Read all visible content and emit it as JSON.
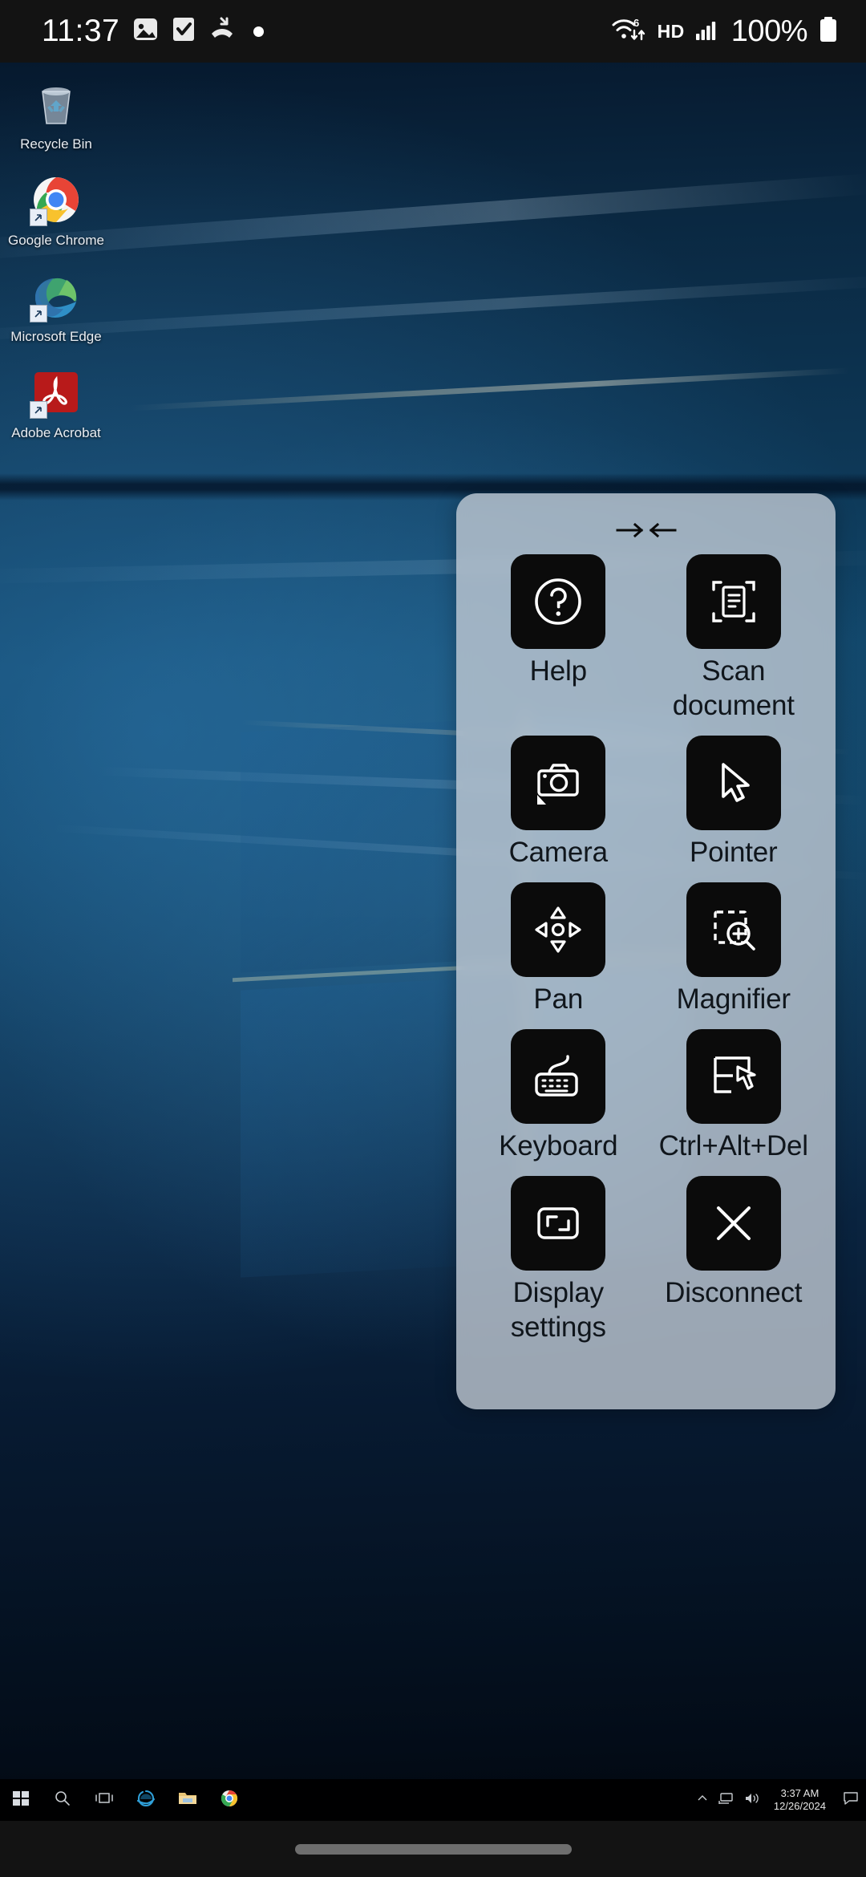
{
  "status_bar": {
    "time": "11:37",
    "battery_percent": "100%",
    "network_label": "HD",
    "wifi_generation": "6",
    "icons": [
      "image-icon",
      "check-square-icon",
      "missed-call-icon",
      "dot-icon",
      "wifi-6-icon",
      "hd-icon",
      "cellular-signal-icon",
      "battery-icon"
    ]
  },
  "desktop": {
    "icons": [
      {
        "label": "Recycle Bin",
        "icon": "recycle-bin-icon",
        "has_shortcut_badge": false
      },
      {
        "label": "Google Chrome",
        "icon": "chrome-icon",
        "has_shortcut_badge": true
      },
      {
        "label": "Microsoft Edge",
        "icon": "edge-icon",
        "has_shortcut_badge": true
      },
      {
        "label": "Adobe Acrobat",
        "icon": "acrobat-icon",
        "has_shortcut_badge": true
      }
    ]
  },
  "control_panel": {
    "collapse_icon": "collapse-arrows-icon",
    "items": [
      {
        "label": "Help",
        "icon": "question-circle-icon"
      },
      {
        "label": "Scan document",
        "icon": "scan-document-icon"
      },
      {
        "label": "Camera",
        "icon": "camera-icon"
      },
      {
        "label": "Pointer",
        "icon": "cursor-arrow-icon"
      },
      {
        "label": "Pan",
        "icon": "pan-arrows-icon"
      },
      {
        "label": "Magnifier",
        "icon": "magnifier-icon"
      },
      {
        "label": "Keyboard",
        "icon": "keyboard-icon"
      },
      {
        "label": "Ctrl+Alt+Del",
        "icon": "ctrl-alt-del-icon"
      },
      {
        "label": "Display settings",
        "icon": "display-settings-icon"
      },
      {
        "label": "Disconnect",
        "icon": "close-x-icon"
      }
    ]
  },
  "taskbar": {
    "buttons": [
      {
        "name": "start-button",
        "icon": "windows-logo-icon"
      },
      {
        "name": "search-button",
        "icon": "search-icon"
      },
      {
        "name": "task-view-button",
        "icon": "task-view-icon"
      },
      {
        "name": "internet-explorer-button",
        "icon": "internet-explorer-icon"
      },
      {
        "name": "file-explorer-button",
        "icon": "folder-icon"
      },
      {
        "name": "chrome-taskbar-button",
        "icon": "chrome-icon"
      }
    ],
    "tray": {
      "show_hidden_icon": "chevron-up-icon",
      "network_icon": "network-icon",
      "volume_icon": "speaker-icon",
      "time": "3:37 AM",
      "date": "12/26/2024",
      "action_center_icon": "notification-icon"
    }
  },
  "colors": {
    "panel_bg": "#c0c9d3",
    "tile_bg": "#0b0b0b",
    "label_text": "#10161c",
    "status_bar_bg": "#131313",
    "nav_pill": "#6e6e6e"
  }
}
